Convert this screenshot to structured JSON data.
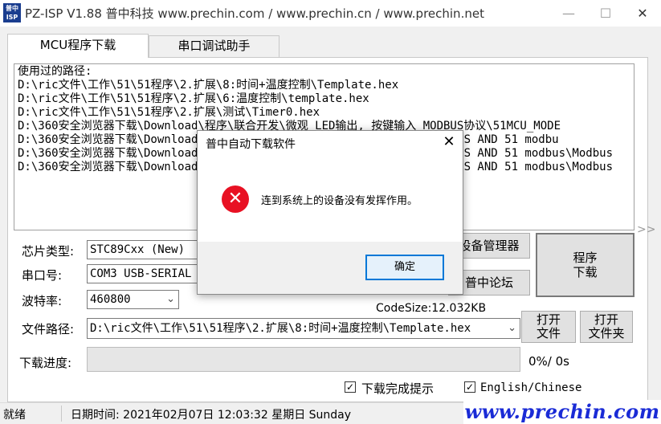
{
  "window": {
    "title": "PZ-ISP V1.88 普中科技 www.prechin.com / www.prechin.cn / www.prechin.net",
    "icon_text": [
      "普中",
      "ISP"
    ],
    "minimize_glyph": "—",
    "maximize_glyph": "☐",
    "close_glyph": "✕"
  },
  "tabs": [
    {
      "label": "MCU程序下载",
      "active": true
    },
    {
      "label": "串口调试助手",
      "active": false
    }
  ],
  "history": {
    "lines": [
      "使用过的路径:",
      "D:\\ric文件\\工作\\51\\51程序\\2.扩展\\8:时间+温度控制\\Template.hex",
      "D:\\ric文件\\工作\\51\\51程序\\2.扩展\\6:温度控制\\template.hex",
      "D:\\ric文件\\工作\\51\\51程序\\2.扩展\\测试\\Timer0.hex",
      "D:\\360安全浏览器下载\\Download\\程序\\联合开发\\微观 LED输出, 按键输入_MODBUS协议\\51MCU_MODE",
      "D:\\360安全浏览器下载\\Download\\程序\\联合开发\\微观\\MCGS AND 51 modbus\\MCGS AND 51 modbu",
      "D:\\360安全浏览器下载\\Download\\程序\\联合开发\\微观\\MCGS AND 51 modbus\\MCGS AND 51 modbus\\Modbus",
      "D:\\360安全浏览器下载\\Download\\程序\\联合开发\\微观\\MCGS AND 51 modbus\\MCGS AND 51 modbus\\Modbus"
    ],
    "right_glyph": ">>"
  },
  "form": {
    "chip_label": "芯片类型:",
    "chip_value": "STC89Cxx (New)",
    "port_label": "串口号:",
    "port_value": "COM3  USB-SERIAL CH340",
    "baud_label": "波特率:",
    "baud_value": "460800",
    "file_label": "文件路径:",
    "file_value": "D:\\ric文件\\工作\\51\\51程序\\2.扩展\\8:时间+温度控制\\Template.hex",
    "progress_label": "下载进度:",
    "progress_fraction": 0,
    "progress_text": "0%/ 0s",
    "codesize_text": "CodeSize:12.032KB"
  },
  "buttons": {
    "device_manager": "设备管理器",
    "forum": "普中论坛",
    "program_download": [
      "程序",
      "下载"
    ],
    "open_file": [
      "打开",
      "文件"
    ],
    "open_folder": [
      "打开",
      "文件夹"
    ]
  },
  "checkboxes": {
    "done_prompt": {
      "label": "下载完成提示",
      "checked": true
    },
    "language": {
      "label": "English/Chinese",
      "checked": true
    },
    "check_glyph": "✓"
  },
  "statusbar": {
    "state": "就绪",
    "datetime": "日期时间:  2021年02月07日  12:03:32  星期日  Sunday",
    "brand": "www.prechin.com"
  },
  "dialog": {
    "title": "普中自动下载软件",
    "close_glyph": "✕",
    "icon": "error-icon",
    "icon_glyph": "✕",
    "message": "连到系统上的设备没有发挥作用。",
    "ok_label": "确定"
  },
  "colors": {
    "error_red": "#e81123",
    "brand_blue": "#1a2bd6",
    "focus_blue": "#0078d7"
  }
}
